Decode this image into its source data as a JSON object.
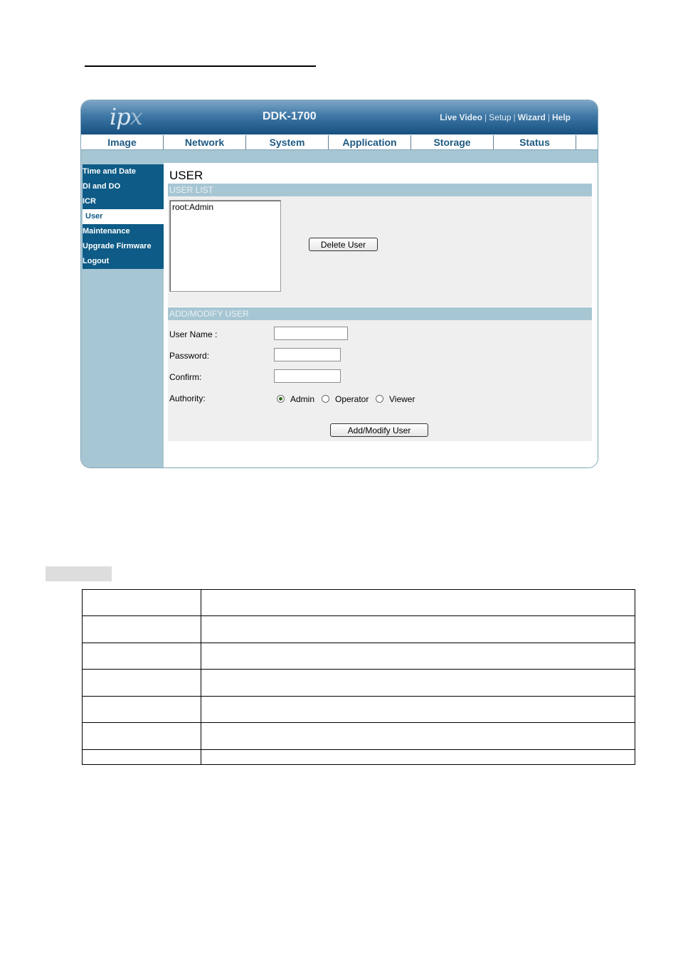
{
  "app": {
    "logo": "ipx",
    "model": "DDK-1700",
    "top_links": [
      "Live Video",
      "Setup",
      "Wizard",
      "Help"
    ]
  },
  "tabs": [
    "Image",
    "Network",
    "System",
    "Application",
    "Storage",
    "Status"
  ],
  "sidebar": {
    "items": [
      {
        "label": "Time and Date",
        "active": false
      },
      {
        "label": "DI and DO",
        "active": false
      },
      {
        "label": "ICR",
        "active": false
      },
      {
        "label": "User",
        "active": true
      },
      {
        "label": "Maintenance",
        "active": false
      },
      {
        "label": "Upgrade Firmware",
        "active": false
      },
      {
        "label": "Logout",
        "active": false
      }
    ]
  },
  "main": {
    "title": "USER",
    "user_list": {
      "heading": "USER LIST",
      "entries": [
        "root:Admin"
      ],
      "delete_label": "Delete User"
    },
    "add_modify": {
      "heading": "ADD/MODIFY USER",
      "username_label": "User Name :",
      "username_value": "",
      "password_label": "Password:",
      "password_value": "",
      "confirm_label": "Confirm:",
      "confirm_value": "",
      "authority_label": "Authority:",
      "authority_options": [
        "Admin",
        "Operator",
        "Viewer"
      ],
      "authority_selected": "Admin",
      "submit_label": "Add/Modify User"
    }
  },
  "colors": {
    "nav_blue": "#0d5b86",
    "panel_blue": "#a7c6d3",
    "section_bg": "#efefef"
  }
}
